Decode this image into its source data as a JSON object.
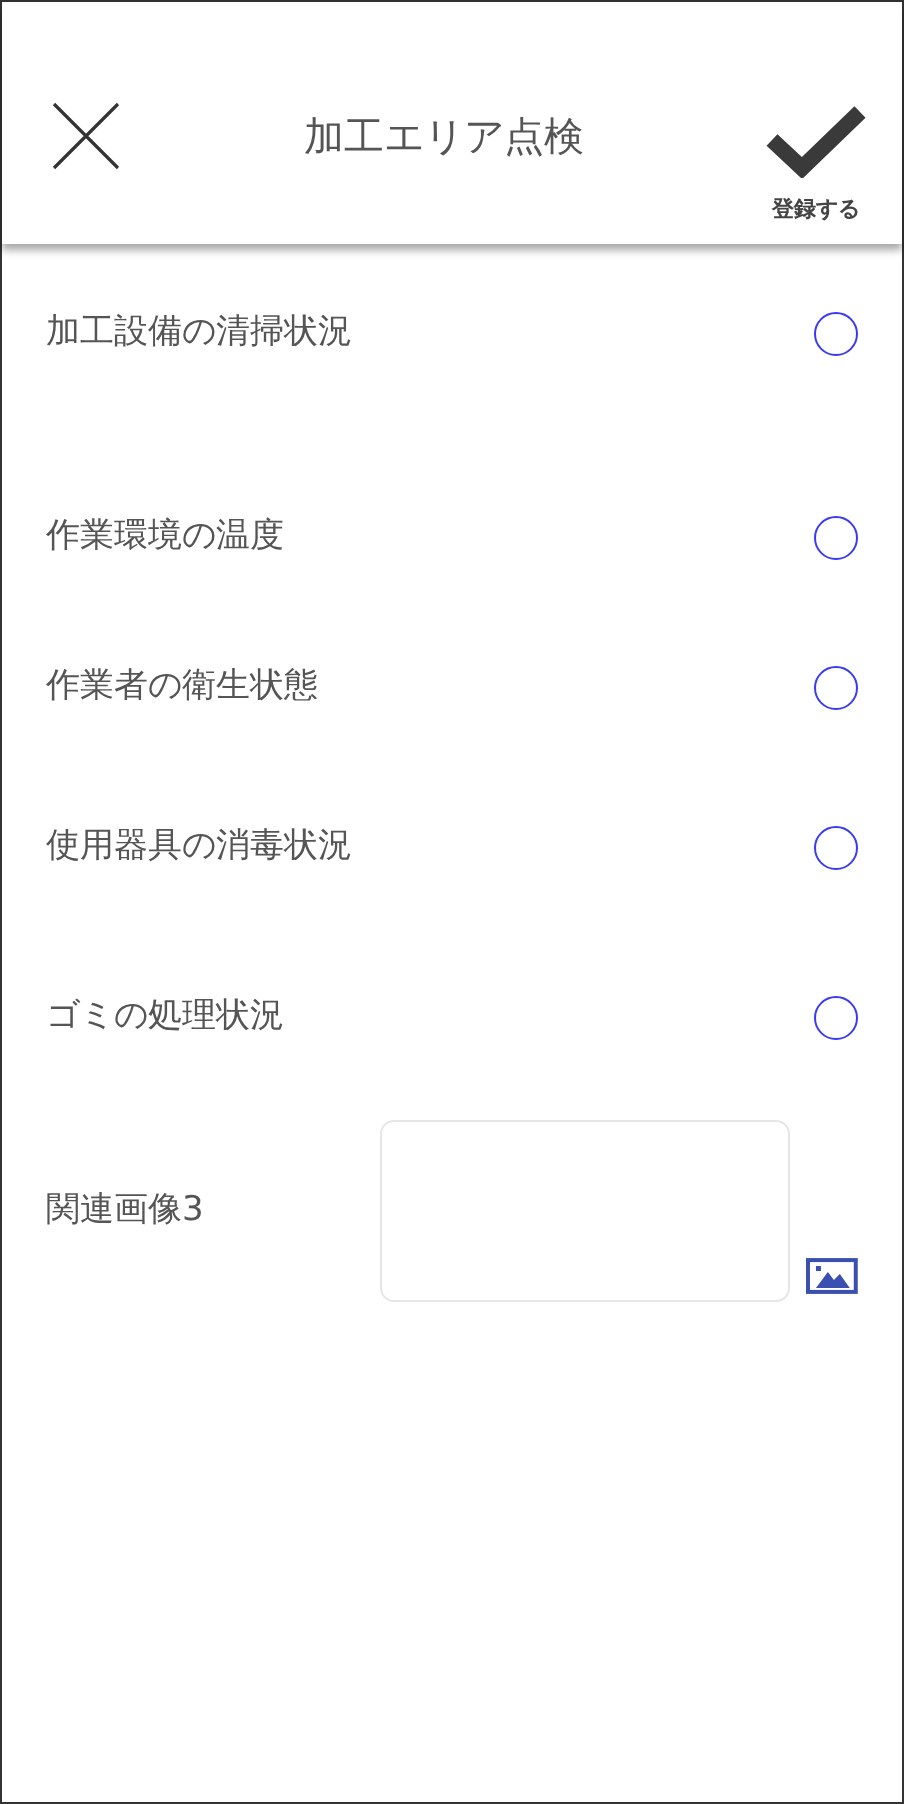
{
  "header": {
    "title": "加工エリア点検",
    "save_label": "登録する"
  },
  "items": [
    {
      "label": "加工設備の清掃状況",
      "selected": false
    },
    {
      "label": "作業環境の温度",
      "selected": false
    },
    {
      "label": "作業者の衛生状態",
      "selected": false
    },
    {
      "label": "使用器具の消毒状況",
      "selected": false
    },
    {
      "label": "ゴミの処理状況",
      "selected": false
    }
  ],
  "image_field": {
    "label": "関連画像3"
  }
}
